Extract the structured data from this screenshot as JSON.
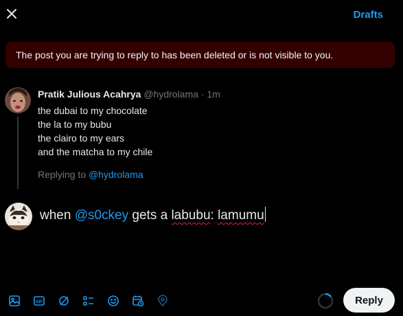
{
  "header": {
    "drafts_label": "Drafts"
  },
  "alert": {
    "text": "The post you are trying to reply to has been deleted or is not visible to you."
  },
  "parent_post": {
    "author_name": "Pratik Julious Acahrya",
    "author_handle": "@hydrolama",
    "separator": "·",
    "time": "1m",
    "lines": [
      "the dubai to my chocolate",
      "the la to my bubu",
      "the clairo to my ears",
      "and the matcha to my chile"
    ],
    "replying_prefix": "Replying to",
    "replying_handle": "@hydrolama"
  },
  "composer": {
    "text_before": "when",
    "mention": "@s0ckey",
    "text_middle": "gets a",
    "word_1": "labubu",
    "text_colon": ":",
    "word_2": "lamumu"
  },
  "toolbar": {
    "icons": [
      "image-icon",
      "gif-icon",
      "grok-icon",
      "poll-icon",
      "emoji-icon",
      "schedule-icon",
      "location-icon"
    ]
  },
  "reply_button": {
    "label": "Reply"
  },
  "colors": {
    "accent": "#1d9bf0",
    "alert_bg": "#330000",
    "muted": "#71767b",
    "spellcheck": "#e0245e"
  }
}
